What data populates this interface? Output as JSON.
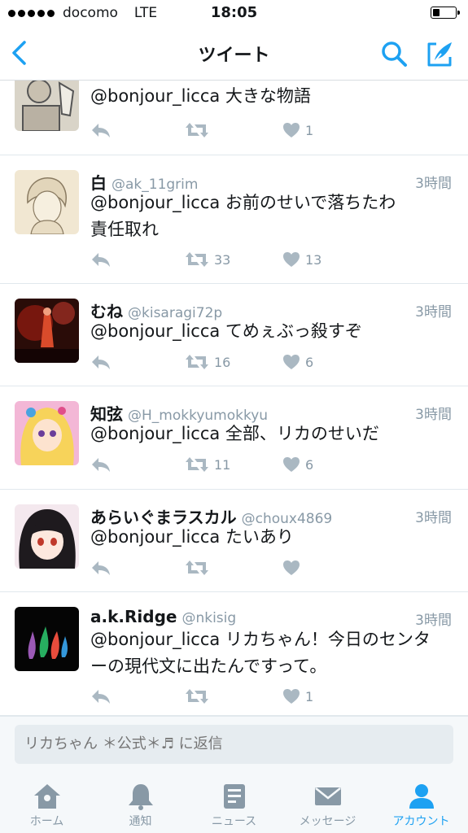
{
  "status_bar": {
    "carrier": "docomo",
    "network": "LTE",
    "time": "18:05",
    "battery_level": 0.3
  },
  "nav": {
    "title": "ツイート"
  },
  "tweets": [
    {
      "name": "",
      "handle": "",
      "time": "",
      "text": "@bonjour_licca 大きな物語",
      "retweets": "",
      "likes": "1"
    },
    {
      "name": "白",
      "handle": "@ak_11grim",
      "time": "3時間",
      "text": "@bonjour_licca お前のせいで落ちたわ\n責任取れ",
      "retweets": "33",
      "likes": "13"
    },
    {
      "name": "むね",
      "handle": "@kisaragi72p",
      "time": "3時間",
      "text": "@bonjour_licca てめぇぶっ殺すぞ",
      "retweets": "16",
      "likes": "6"
    },
    {
      "name": "知弦",
      "handle": "@H_mokkyumokkyu",
      "time": "3時間",
      "text": "@bonjour_licca 全部、リカのせいだ",
      "retweets": "11",
      "likes": "6"
    },
    {
      "name": "あらいぐまラスカル",
      "handle": "@choux4869",
      "time": "3時間",
      "text": "@bonjour_licca たいあり",
      "retweets": "",
      "likes": ""
    },
    {
      "name": "a.k.Ridge",
      "handle": "@nkisig",
      "time": "3時間",
      "text": "@bonjour_licca リカちゃん！今日のセンタ\nーの現代文に出たんですって。",
      "retweets": "",
      "likes": "1"
    }
  ],
  "reply": {
    "placeholder": "リカちゃん ＊公式＊♬ に返信"
  },
  "tabs": [
    {
      "label": "ホーム",
      "icon": "home-icon"
    },
    {
      "label": "通知",
      "icon": "bell-icon"
    },
    {
      "label": "ニュース",
      "icon": "news-icon"
    },
    {
      "label": "メッセージ",
      "icon": "envelope-icon"
    },
    {
      "label": "アカウント",
      "icon": "person-icon"
    }
  ],
  "colors": {
    "accent": "#1da1f2",
    "muted": "#8899a6",
    "divider": "#e1e8ed"
  }
}
